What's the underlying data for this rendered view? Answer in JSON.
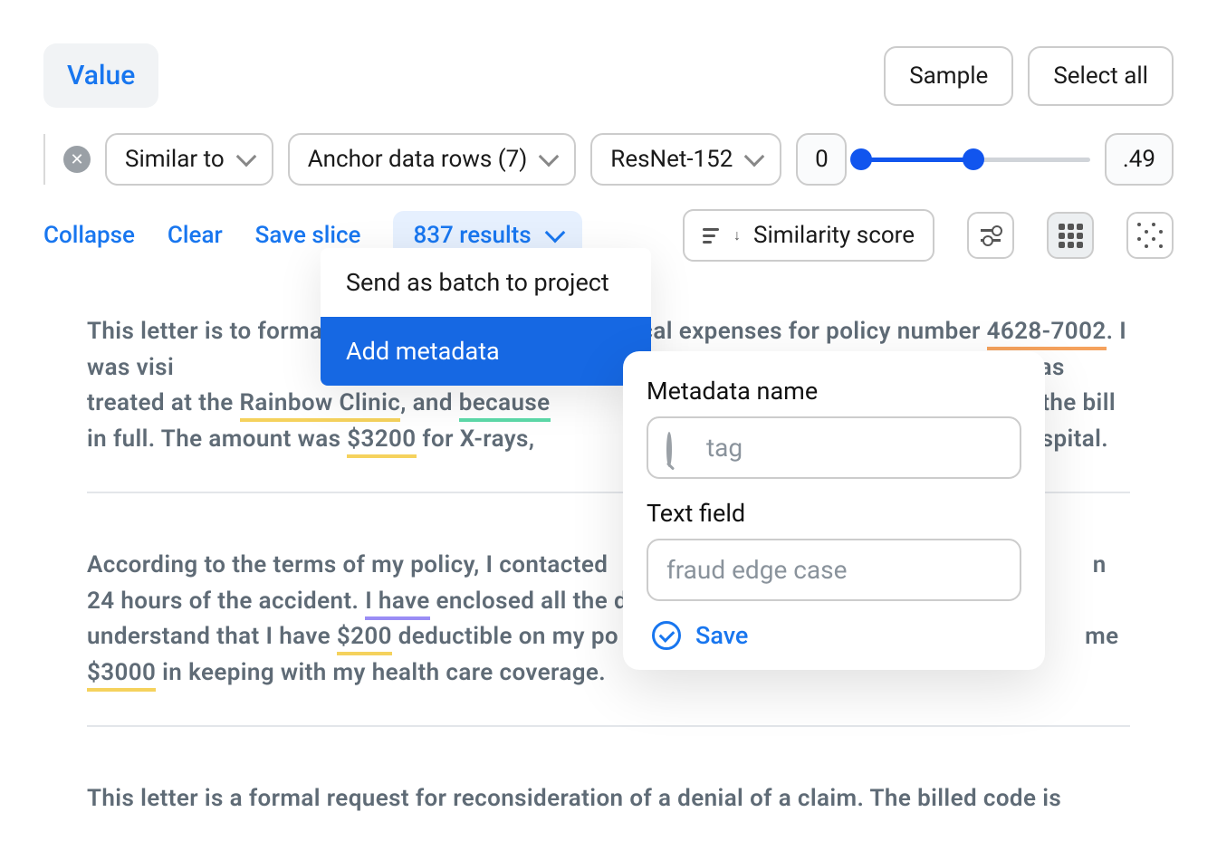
{
  "header": {
    "value_pill": "Value",
    "sample": "Sample",
    "select_all": "Select all"
  },
  "filters": {
    "similar_to": "Similar to",
    "anchor": "Anchor data rows (7)",
    "model": "ResNet-152",
    "range_low": "0",
    "range_high": ".49",
    "slider_pct": 49
  },
  "links": {
    "collapse": "Collapse",
    "clear": "Clear",
    "save_slice": "Save slice",
    "results": "837 results",
    "sort": "Similarity score"
  },
  "dropdown": {
    "item1": "Send as batch to project",
    "item2": "Add metadata"
  },
  "popover": {
    "label1": "Metadata name",
    "value1": "tag",
    "label2": "Text field",
    "value2": "fraud edge case",
    "save": "Save"
  },
  "results": {
    "r1_a": "This letter is to forma",
    "r1_b": " medical expenses for policy number ",
    "r1_policy": "4628-7002",
    "r1_c": ". I was visi",
    "r1_d": "wrist. I was treated at the ",
    "r1_clinic": "Rainbow Clinic",
    "r1_e": ", and ",
    "r1_because": "because",
    "r1_f": "ay the bill in full. The amount was ",
    "r1_amt": "$3200",
    "r1_g": " for X-rays,",
    "r1_h": "e hospital.",
    "r2_a": "According to the terms of my policy, I contacted ",
    "r2_b": "n 24 hours of the accident. ",
    "r2_have": "I have",
    "r2_c": " enclosed all the doc",
    "r2_d": " understand that I have ",
    "r2_amt1": "$200",
    "r2_e": " deductible on my po",
    "r2_f": " me ",
    "r2_amt2": "$3000",
    "r2_g": " in keeping with my health care coverage.",
    "r3": "This letter is a formal request for reconsideration of a denial of a claim. The billed code is"
  }
}
